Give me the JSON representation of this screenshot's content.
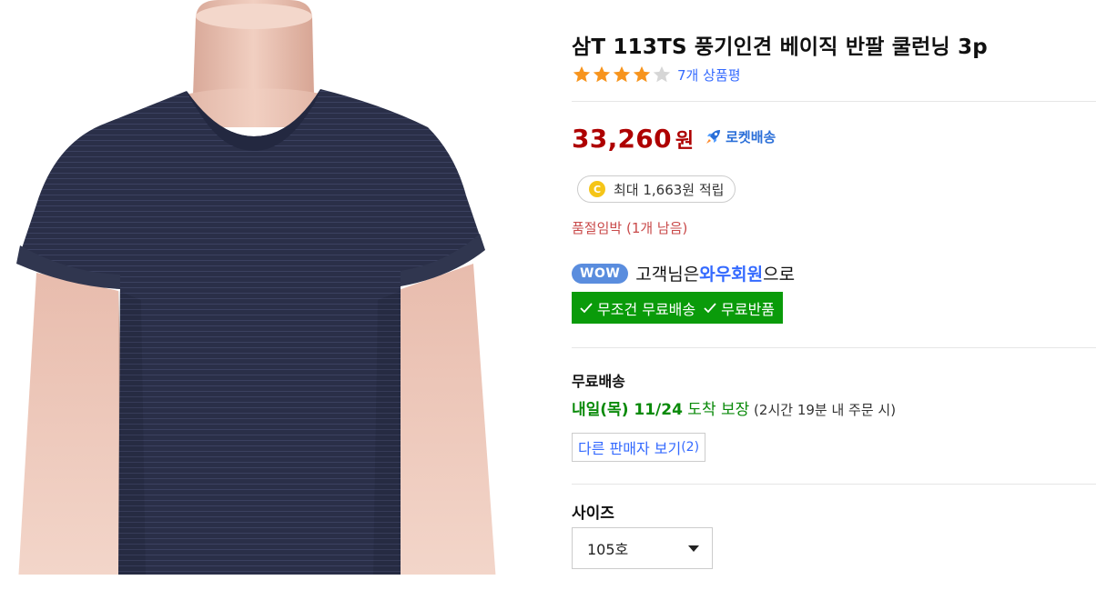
{
  "product": {
    "title": "삼T 113TS 풍기인견 베이직 반팔 쿨런닝 3p",
    "rating_value": 4,
    "rating_max": 5,
    "review_count_text": "7개 상품평",
    "image_icon": "tshirt-mannequin-image"
  },
  "price": {
    "amount": "33,260",
    "currency": "원",
    "rocket_label": "로켓배송",
    "rocket_icon": "rocket-icon"
  },
  "reward": {
    "coin_symbol": "C",
    "text": "최대 1,663원 적립"
  },
  "stock_text": "품절임박 (1개 남음)",
  "wow": {
    "badge": "WOW",
    "prefix": "고객님은 ",
    "member": "와우회원",
    "suffix": "으로",
    "benefit_1": "무조건 무료배송",
    "benefit_2": "무료반품"
  },
  "shipping": {
    "label": "무료배송",
    "arrival_day": "내일(목) 11/24",
    "arrival_word": " 도착 보장",
    "arrival_note": " (2시간 19분 내 주문 시)"
  },
  "seller": {
    "button_label": "다른 판매자 보기",
    "count": "(2)"
  },
  "size": {
    "label": "사이즈",
    "selected": "105호"
  },
  "colors": {
    "price_red": "#ae0000",
    "link_blue": "#346aff",
    "wow_green": "#0a9b0a",
    "star_orange": "#f7941d",
    "stock_red": "#c94a4a"
  }
}
